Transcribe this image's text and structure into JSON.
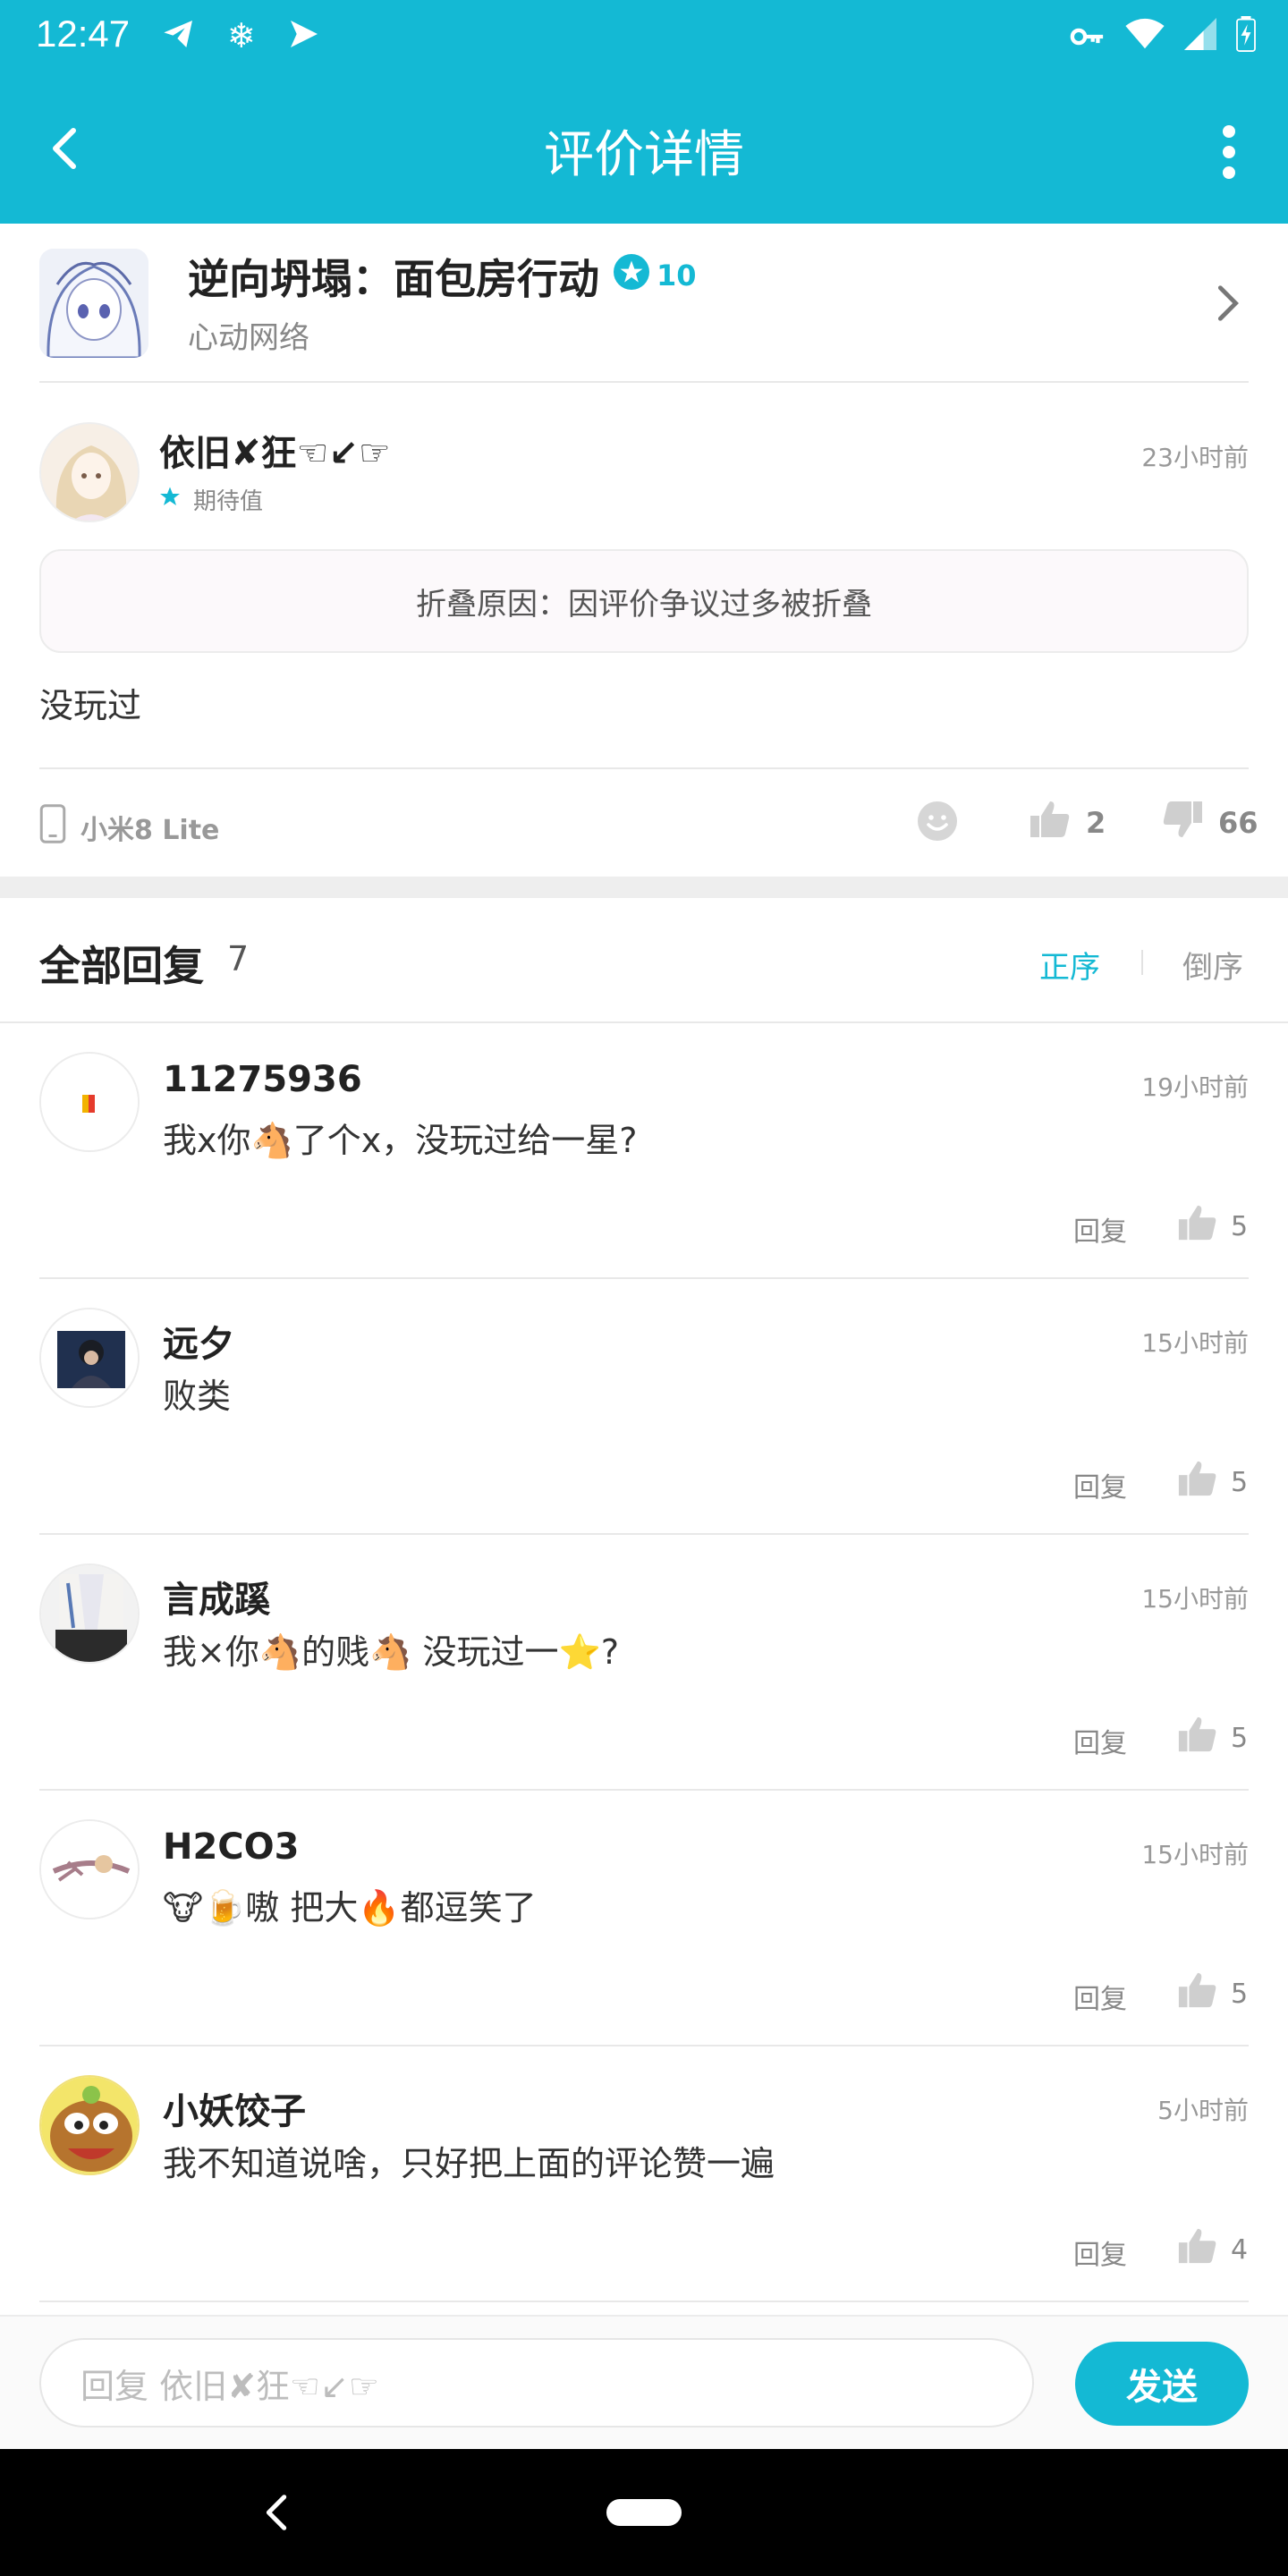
{
  "status_bar": {
    "time": "12:47"
  },
  "header": {
    "title": "评价详情"
  },
  "game": {
    "name": "逆向坍塌：面包房行动",
    "score": "10",
    "developer": "心动网络"
  },
  "review": {
    "author": "依旧✘狂☜↙☞",
    "time": "23小时前",
    "rating_label": "期待值",
    "fold_reason": "折叠原因：因评价争议过多被折叠",
    "content": "没玩过",
    "device": "小米8 Lite",
    "likes": "2",
    "dislikes": "66"
  },
  "replies_section": {
    "title": "全部回复",
    "count": "7",
    "sort_asc": "正序",
    "sort_desc": "倒序"
  },
  "replies": [
    {
      "name": "11275936",
      "time": "19小时前",
      "text": "我x你🐴了个x，没玩过给一星?",
      "reply_label": "回复",
      "likes": "5"
    },
    {
      "name": "远夕",
      "time": "15小时前",
      "text": "败类",
      "reply_label": "回复",
      "likes": "5"
    },
    {
      "name": "言成蹊",
      "time": "15小时前",
      "text": "我×你🐴的贱🐴 没玩过一⭐?",
      "reply_label": "回复",
      "likes": "5"
    },
    {
      "name": "H2CO3",
      "time": "15小时前",
      "text": "🐮🍺嗷  把大🔥都逗笑了",
      "reply_label": "回复",
      "likes": "5"
    },
    {
      "name": "小妖饺子",
      "time": "5小时前",
      "text": "我不知道说啥，只好把上面的评论赞一遍",
      "reply_label": "回复",
      "likes": "4"
    }
  ],
  "input": {
    "placeholder": "回复 依旧✘狂☜↙☞",
    "send_label": "发送"
  },
  "colors": {
    "accent": "#14b9d4",
    "divider": "#e8e8e8"
  }
}
